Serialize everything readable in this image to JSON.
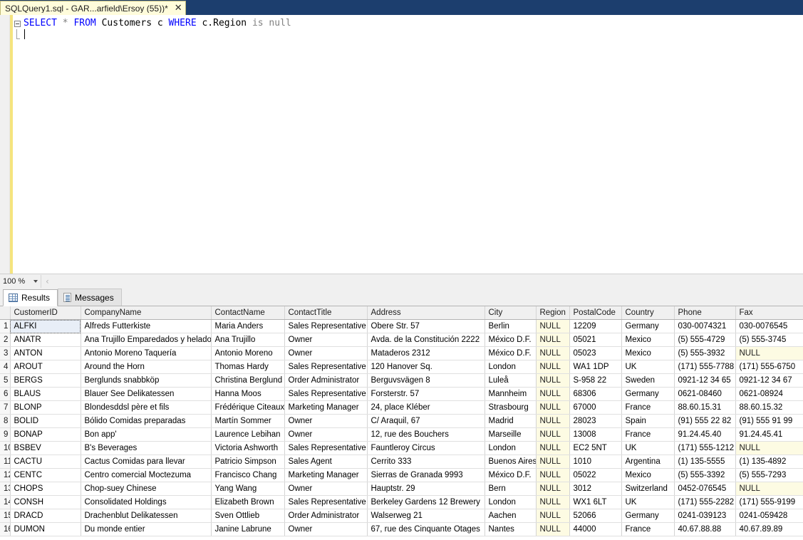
{
  "window": {
    "document_tab": {
      "label": "SQLQuery1.sql - GAR...arfield\\Ersoy (55))*",
      "close_label": "✕"
    }
  },
  "editor": {
    "fold_icon": "collapse-minus",
    "query_tokens": [
      {
        "text": "SELECT",
        "type": "keyword"
      },
      {
        "text": " ",
        "type": "plain"
      },
      {
        "text": "*",
        "type": "operator"
      },
      {
        "text": " ",
        "type": "plain"
      },
      {
        "text": "FROM",
        "type": "keyword"
      },
      {
        "text": " Customers c ",
        "type": "plain"
      },
      {
        "text": "WHERE",
        "type": "keyword"
      },
      {
        "text": " c.Region ",
        "type": "plain"
      },
      {
        "text": "is null",
        "type": "null"
      }
    ],
    "query_text": "SELECT * FROM Customers c WHERE c.Region is null"
  },
  "zoombar": {
    "zoom_level": "100 %",
    "nav_back": "‹"
  },
  "result_tabs": [
    {
      "label": "Results",
      "icon": "grid-icon",
      "active": true
    },
    {
      "label": "Messages",
      "icon": "message-icon",
      "active": false
    }
  ],
  "grid": {
    "columns": [
      {
        "name": "CustomerID",
        "width": 99
      },
      {
        "name": "CompanyName",
        "width": 183
      },
      {
        "name": "ContactName",
        "width": 103
      },
      {
        "name": "ContactTitle",
        "width": 116
      },
      {
        "name": "Address",
        "width": 165
      },
      {
        "name": "City",
        "width": 72
      },
      {
        "name": "Region",
        "width": 47
      },
      {
        "name": "PostalCode",
        "width": 73
      },
      {
        "name": "Country",
        "width": 74
      },
      {
        "name": "Phone",
        "width": 86
      },
      {
        "name": "Fax",
        "width": 95
      }
    ],
    "null_text": "NULL",
    "rows": [
      {
        "n": "1",
        "cells": [
          "ALFKI",
          "Alfreds Futterkiste",
          "Maria Anders",
          "Sales Representative",
          "Obere Str. 57",
          "Berlin",
          "NULL",
          "12209",
          "Germany",
          "030-0074321",
          "030-0076545"
        ]
      },
      {
        "n": "2",
        "cells": [
          "ANATR",
          "Ana Trujillo Emparedados y helados",
          "Ana Trujillo",
          "Owner",
          "Avda. de la Constitución 2222",
          "México D.F.",
          "NULL",
          "05021",
          "Mexico",
          "(5) 555-4729",
          "(5) 555-3745"
        ]
      },
      {
        "n": "3",
        "cells": [
          "ANTON",
          "Antonio Moreno Taquería",
          "Antonio Moreno",
          "Owner",
          "Mataderos  2312",
          "México D.F.",
          "NULL",
          "05023",
          "Mexico",
          "(5) 555-3932",
          "NULL"
        ]
      },
      {
        "n": "4",
        "cells": [
          "AROUT",
          "Around the Horn",
          "Thomas Hardy",
          "Sales Representative",
          "120 Hanover Sq.",
          "London",
          "NULL",
          "WA1 1DP",
          "UK",
          "(171) 555-7788",
          "(171) 555-6750"
        ]
      },
      {
        "n": "5",
        "cells": [
          "BERGS",
          "Berglunds snabbköp",
          "Christina Berglund",
          "Order Administrator",
          "Berguvsvägen  8",
          "Luleå",
          "NULL",
          "S-958 22",
          "Sweden",
          "0921-12 34 65",
          "0921-12 34 67"
        ]
      },
      {
        "n": "6",
        "cells": [
          "BLAUS",
          "Blauer See Delikatessen",
          "Hanna Moos",
          "Sales Representative",
          "Forsterstr. 57",
          "Mannheim",
          "NULL",
          "68306",
          "Germany",
          "0621-08460",
          "0621-08924"
        ]
      },
      {
        "n": "7",
        "cells": [
          "BLONP",
          "Blondesddsl père et fils",
          "Frédérique Citeaux",
          "Marketing Manager",
          "24, place Kléber",
          "Strasbourg",
          "NULL",
          "67000",
          "France",
          "88.60.15.31",
          "88.60.15.32"
        ]
      },
      {
        "n": "8",
        "cells": [
          "BOLID",
          "Bólido Comidas preparadas",
          "Martín Sommer",
          "Owner",
          "C/ Araquil, 67",
          "Madrid",
          "NULL",
          "28023",
          "Spain",
          "(91) 555 22 82",
          "(91) 555 91 99"
        ]
      },
      {
        "n": "9",
        "cells": [
          "BONAP",
          "Bon app'",
          "Laurence Lebihan",
          "Owner",
          "12, rue des Bouchers",
          "Marseille",
          "NULL",
          "13008",
          "France",
          "91.24.45.40",
          "91.24.45.41"
        ]
      },
      {
        "n": "10",
        "cells": [
          "BSBEV",
          "B's Beverages",
          "Victoria Ashworth",
          "Sales Representative",
          "Fauntleroy Circus",
          "London",
          "NULL",
          "EC2 5NT",
          "UK",
          "(171) 555-1212",
          "NULL"
        ]
      },
      {
        "n": "11",
        "cells": [
          "CACTU",
          "Cactus Comidas para llevar",
          "Patricio Simpson",
          "Sales Agent",
          "Cerrito 333",
          "Buenos Aires",
          "NULL",
          "1010",
          "Argentina",
          "(1) 135-5555",
          "(1) 135-4892"
        ]
      },
      {
        "n": "12",
        "cells": [
          "CENTC",
          "Centro comercial Moctezuma",
          "Francisco Chang",
          "Marketing Manager",
          "Sierras de Granada 9993",
          "México D.F.",
          "NULL",
          "05022",
          "Mexico",
          "(5) 555-3392",
          "(5) 555-7293"
        ]
      },
      {
        "n": "13",
        "cells": [
          "CHOPS",
          "Chop-suey Chinese",
          "Yang Wang",
          "Owner",
          "Hauptstr. 29",
          "Bern",
          "NULL",
          "3012",
          "Switzerland",
          "0452-076545",
          "NULL"
        ]
      },
      {
        "n": "14",
        "cells": [
          "CONSH",
          "Consolidated Holdings",
          "Elizabeth Brown",
          "Sales Representative",
          "Berkeley Gardens 12  Brewery",
          "London",
          "NULL",
          "WX1 6LT",
          "UK",
          "(171) 555-2282",
          "(171) 555-9199"
        ]
      },
      {
        "n": "15",
        "cells": [
          "DRACD",
          "Drachenblut Delikatessen",
          "Sven Ottlieb",
          "Order Administrator",
          "Walserweg 21",
          "Aachen",
          "NULL",
          "52066",
          "Germany",
          "0241-039123",
          "0241-059428"
        ]
      },
      {
        "n": "16",
        "cells": [
          "DUMON",
          "Du monde entier",
          "Janine Labrune",
          "Owner",
          "67, rue des Cinquante Otages",
          "Nantes",
          "NULL",
          "44000",
          "France",
          "40.67.88.88",
          "40.67.89.89"
        ]
      }
    ],
    "selected_cell": {
      "row": 0,
      "col": 0
    }
  },
  "colors": {
    "tab_strip_bg": "#1c3e6e",
    "doc_tab_bg": "#fffcdb",
    "keyword": "#0000ff",
    "null_cell_bg": "#fdfbe3",
    "change_bar": "#f5e47e",
    "chrome_bg": "#f0f0f0"
  }
}
